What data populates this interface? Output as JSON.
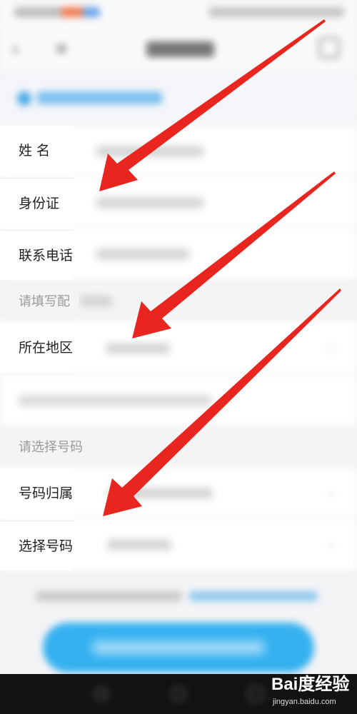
{
  "form": {
    "rows": [
      {
        "label": "姓 名"
      },
      {
        "label": "身份证"
      },
      {
        "label": "联系电话"
      },
      {
        "label": "所在地区"
      },
      {
        "label": "号码归属"
      },
      {
        "label": "选择号码"
      }
    ],
    "sections": [
      {
        "label": "请填写配"
      },
      {
        "label": "请选择号码"
      }
    ]
  },
  "watermark": {
    "logo": "Bai度经验",
    "site": "jingyan.baidu.com"
  },
  "colors": {
    "accent": "#35b1f0",
    "arrow": "#e8261f"
  },
  "icons": {
    "back": "chevron-left-icon",
    "close": "close-icon",
    "more": "more-icon",
    "chevron": "chevron-right-icon"
  }
}
